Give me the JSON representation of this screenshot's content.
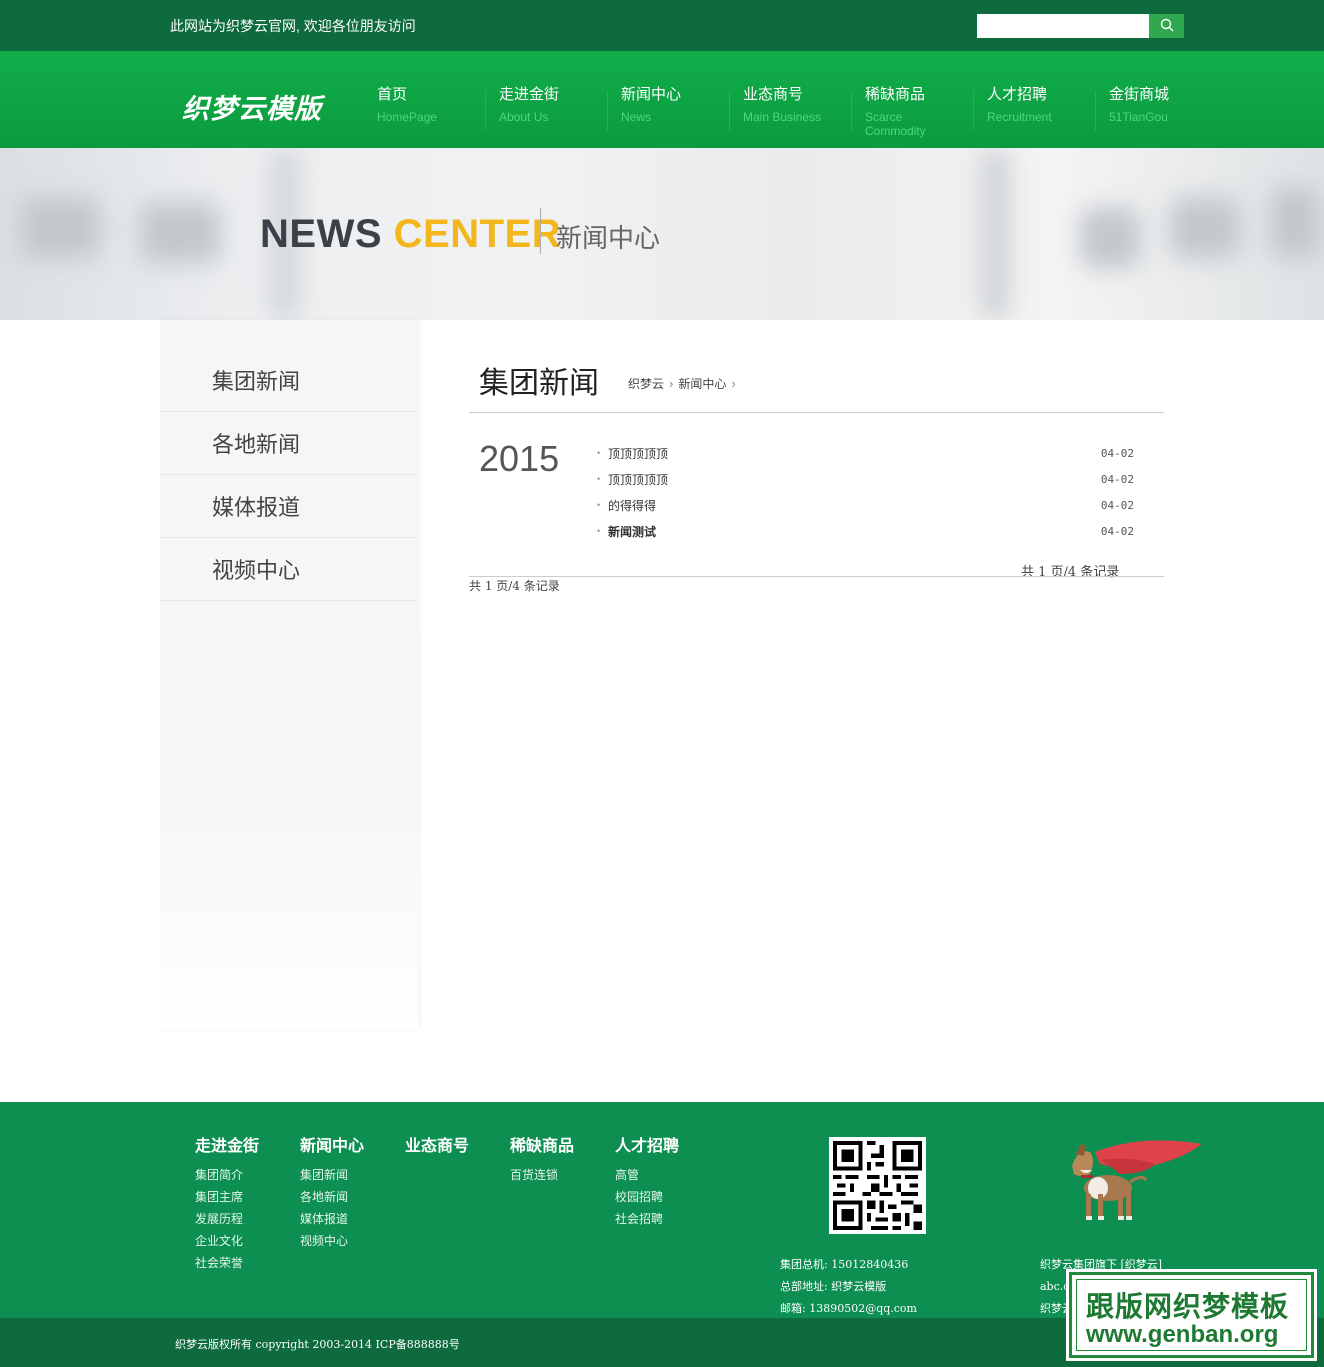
{
  "topbar": {
    "welcome": "此网站为织梦云官网, 欢迎各位朋友访问",
    "search_placeholder": "",
    "search_icon": "search-icon"
  },
  "header": {
    "logo": "织梦云模版",
    "nav": [
      {
        "cn": "首页",
        "en": "HomePage"
      },
      {
        "cn": "走进金街",
        "en": "About Us"
      },
      {
        "cn": "新闻中心",
        "en": "News"
      },
      {
        "cn": "业态商号",
        "en": "Main Business"
      },
      {
        "cn": "稀缺商品",
        "en": "Scarce Commodity"
      },
      {
        "cn": "人才招聘",
        "en": "Recruitment"
      },
      {
        "cn": "金街商城",
        "en": "51TianGou"
      }
    ]
  },
  "banner": {
    "en_dark": "NEWS",
    "en_accent": "CENTER",
    "cn": "新闻中心",
    "accent_color": "#f3b61c"
  },
  "sidebar": {
    "items": [
      "集团新闻",
      "各地新闻",
      "媒体报道",
      "视频中心"
    ]
  },
  "main": {
    "title": "集团新闻",
    "breadcrumb": [
      "织梦云",
      "新闻中心"
    ],
    "year": "2015",
    "news": [
      {
        "title": "顶顶顶顶顶",
        "date": "04-02",
        "bold": false
      },
      {
        "title": "顶顶顶顶顶",
        "date": "04-02",
        "bold": false
      },
      {
        "title": "的得得得",
        "date": "04-02",
        "bold": false
      },
      {
        "title": "新闻测试",
        "date": "04-02",
        "bold": true
      }
    ],
    "pager_right": "共 1 页/4 条记录",
    "pager_left": "共 1 页/4 条记录"
  },
  "footer": {
    "columns": [
      {
        "head": "走进金街",
        "links": [
          "集团简介",
          "集团主席",
          "发展历程",
          "企业文化",
          "社会荣誉"
        ]
      },
      {
        "head": "新闻中心",
        "links": [
          "集团新闻",
          "各地新闻",
          "媒体报道",
          "视频中心"
        ]
      },
      {
        "head": "业态商号",
        "links": []
      },
      {
        "head": "稀缺商品",
        "links": [
          "百货连锁"
        ]
      },
      {
        "head": "人才招聘",
        "links": [
          "高管",
          "校园招聘",
          "社会招聘"
        ]
      }
    ],
    "contact": {
      "phone": "集团总机: 15012840436",
      "address": "总部地址: 织梦云模版",
      "email": "邮箱: 13890502@qq.com"
    },
    "brand": [
      "织梦云集团旗下 [织梦云]",
      "abc.c",
      "织梦云"
    ],
    "copyright": "织梦云版权所有 copyright 2003-2014 ICP备888888号",
    "colors": {
      "footer": "#0d8f52",
      "bar": "#0e6b3e"
    }
  },
  "watermark": {
    "cn": "跟版网织梦模板",
    "url": "www.genban.org"
  }
}
